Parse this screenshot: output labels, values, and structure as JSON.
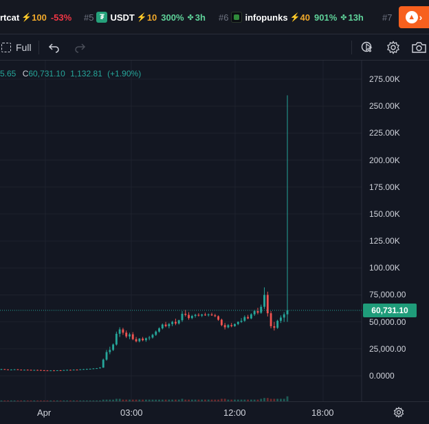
{
  "ticker": {
    "items": [
      {
        "rank": "",
        "name": "rtcat",
        "score": "100",
        "change": "-53%",
        "age": ""
      },
      {
        "rank": "#5",
        "name": "USDT",
        "score": "10",
        "change": "300%",
        "age": "3h"
      },
      {
        "rank": "#6",
        "name": "infopunks",
        "score": "40",
        "change": "901%",
        "age": "13h"
      },
      {
        "rank": "#7",
        "name": "",
        "score": "",
        "change": "",
        "age": ""
      }
    ],
    "bolt_glyph": "⚡",
    "sprout_glyph": "🌱",
    "fire_button_arrow": "›",
    "colors": {
      "negative": "#f23645",
      "positive": "#5fd39a",
      "score": "#f0a82a",
      "fire": "#f7601e"
    }
  },
  "toolbar": {
    "full_label": "Full",
    "icons": [
      "fullscreen-icon",
      "undo-icon",
      "redo-icon",
      "cursor-icon",
      "gear-icon",
      "camera-icon"
    ]
  },
  "legend": {
    "prev_fragment": "5.65",
    "close_prefix": "C",
    "close": "60,731.10",
    "change": "1,132.81",
    "change_pct": "(+1.90%)"
  },
  "current_price": "60,731.10",
  "time_axis": {
    "labels": [
      "Apr",
      "03:00",
      "12:00",
      "18:00"
    ]
  },
  "chart_data": {
    "type": "candlestick",
    "y_labels": [
      "275.00K",
      "250.00K",
      "225.00K",
      "200.00K",
      "175.00K",
      "150.00K",
      "125.00K",
      "100.00K",
      "75,000.00",
      "50,000.00",
      "25,000.00",
      "0.0000"
    ],
    "y_values": [
      275000,
      250000,
      225000,
      200000,
      175000,
      150000,
      125000,
      100000,
      75000,
      50000,
      25000,
      0
    ],
    "ylim": [
      -20000,
      290000
    ],
    "current_price": 60731.1,
    "x_labels": [
      "Apr",
      "03:00",
      "12:00",
      "18:00"
    ],
    "colors": {
      "up": "#26a69a",
      "down": "#ef5350",
      "grid": "#1e222d"
    },
    "candles": [
      [
        6000,
        6500,
        5500,
        6200
      ],
      [
        6200,
        6400,
        5800,
        5900
      ],
      [
        5900,
        6100,
        5400,
        5600
      ],
      [
        5600,
        6000,
        5300,
        5800
      ],
      [
        5800,
        6200,
        5500,
        6000
      ],
      [
        6000,
        6300,
        5600,
        5700
      ],
      [
        5700,
        5900,
        5200,
        5400
      ],
      [
        5400,
        5800,
        5100,
        5600
      ],
      [
        5600,
        5900,
        5300,
        5500
      ],
      [
        5500,
        5800,
        5000,
        5200
      ],
      [
        5200,
        5600,
        4900,
        5400
      ],
      [
        5400,
        5700,
        5100,
        5300
      ],
      [
        5300,
        5600,
        5000,
        5100
      ],
      [
        5100,
        5400,
        4800,
        5000
      ],
      [
        5000,
        5300,
        4600,
        4800
      ],
      [
        4800,
        5200,
        4500,
        5000
      ],
      [
        5000,
        5300,
        4700,
        4900
      ],
      [
        4900,
        5200,
        4600,
        5100
      ],
      [
        5100,
        5400,
        4800,
        5000
      ],
      [
        5000,
        5500,
        4800,
        5300
      ],
      [
        5300,
        5700,
        5000,
        5500
      ],
      [
        5500,
        5800,
        5200,
        5400
      ],
      [
        5400,
        5900,
        5200,
        5700
      ],
      [
        5700,
        6000,
        5400,
        5600
      ],
      [
        5600,
        6200,
        5400,
        6000
      ],
      [
        6000,
        6400,
        5700,
        6200
      ],
      [
        6200,
        6600,
        5900,
        6300
      ],
      [
        6300,
        6700,
        6000,
        6500
      ],
      [
        6500,
        7000,
        6300,
        6800
      ],
      [
        6800,
        7200,
        6500,
        7000
      ],
      [
        7000,
        8000,
        6800,
        7600
      ],
      [
        7600,
        16000,
        7400,
        15000
      ],
      [
        15000,
        24000,
        14000,
        22000
      ],
      [
        22000,
        27000,
        20000,
        24000
      ],
      [
        24000,
        30000,
        23000,
        29000
      ],
      [
        29000,
        41000,
        28000,
        39000
      ],
      [
        39000,
        45000,
        36000,
        43000
      ],
      [
        43000,
        44500,
        38000,
        40000
      ],
      [
        40000,
        42000,
        35000,
        36500
      ],
      [
        36500,
        40000,
        34000,
        38500
      ],
      [
        38500,
        40500,
        33000,
        34000
      ],
      [
        34000,
        36000,
        31000,
        32000
      ],
      [
        32000,
        35000,
        31000,
        34500
      ],
      [
        34500,
        36000,
        32000,
        33000
      ],
      [
        33000,
        35500,
        31500,
        34800
      ],
      [
        34800,
        37000,
        33000,
        35500
      ],
      [
        35500,
        39000,
        34500,
        38000
      ],
      [
        38000,
        42000,
        37000,
        41000
      ],
      [
        41000,
        45000,
        40000,
        44000
      ],
      [
        44000,
        48500,
        43000,
        47500
      ],
      [
        47500,
        50000,
        45000,
        46000
      ],
      [
        46000,
        49000,
        44000,
        48000
      ],
      [
        48000,
        51000,
        46000,
        50000
      ],
      [
        50000,
        53000,
        47000,
        48500
      ],
      [
        48500,
        52000,
        47500,
        51500
      ],
      [
        51500,
        60000,
        50000,
        57500
      ],
      [
        57500,
        61000,
        55000,
        56500
      ],
      [
        56500,
        59000,
        52000,
        53500
      ],
      [
        53500,
        56500,
        52500,
        55500
      ],
      [
        55500,
        57500,
        54000,
        56500
      ],
      [
        56500,
        58000,
        55000,
        55800
      ],
      [
        55800,
        57500,
        54500,
        56800
      ],
      [
        56800,
        58500,
        55500,
        56200
      ],
      [
        56200,
        57800,
        55000,
        56900
      ],
      [
        56900,
        58500,
        55500,
        56100
      ],
      [
        56100,
        57500,
        54500,
        55200
      ],
      [
        55200,
        56000,
        51000,
        52000
      ],
      [
        52000,
        53000,
        46000,
        47000
      ],
      [
        47000,
        49000,
        43000,
        45000
      ],
      [
        45000,
        48000,
        44000,
        47000
      ],
      [
        47000,
        49000,
        45000,
        46000
      ],
      [
        46000,
        48500,
        45500,
        48000
      ],
      [
        48000,
        50500,
        47000,
        50000
      ],
      [
        50000,
        53500,
        49000,
        51000
      ],
      [
        51000,
        56000,
        50000,
        54500
      ],
      [
        54500,
        56500,
        52500,
        53200
      ],
      [
        53200,
        58000,
        52500,
        57000
      ],
      [
        57000,
        61000,
        55500,
        60000
      ],
      [
        60000,
        63000,
        57000,
        58500
      ],
      [
        58500,
        66000,
        57500,
        64000
      ],
      [
        64000,
        82000,
        62000,
        75000
      ],
      [
        75000,
        78000,
        55000,
        58000
      ],
      [
        58000,
        60000,
        44000,
        46000
      ],
      [
        46000,
        50000,
        42000,
        44500
      ],
      [
        44500,
        52000,
        43500,
        51000
      ],
      [
        51000,
        56000,
        49000,
        54000
      ],
      [
        54000,
        59000,
        50000,
        57000
      ],
      [
        57000,
        260000,
        50000,
        60731.1
      ]
    ],
    "volume": [
      1,
      1,
      1,
      1,
      1,
      1,
      1,
      1,
      1,
      1,
      1,
      1,
      1,
      1,
      1,
      1,
      1,
      1,
      1,
      1,
      1,
      1,
      1,
      1,
      1,
      1,
      1,
      1,
      1,
      1,
      1,
      2,
      2,
      2,
      2,
      3,
      3,
      2,
      2,
      2,
      2,
      2,
      2,
      2,
      2,
      2,
      2,
      2,
      2,
      2,
      2,
      2,
      2,
      2,
      2,
      3,
      2,
      2,
      2,
      2,
      2,
      2,
      2,
      2,
      2,
      2,
      2,
      3,
      3,
      2,
      2,
      2,
      2,
      2,
      2,
      2,
      2,
      2,
      2,
      3,
      4,
      4,
      3,
      3,
      3,
      3,
      3,
      6
    ]
  }
}
